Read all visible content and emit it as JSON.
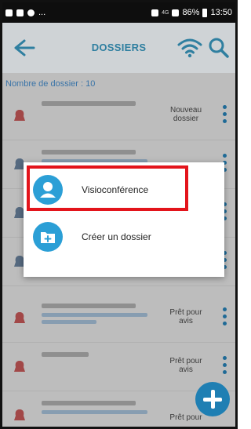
{
  "status_bar": {
    "left_text": "...",
    "battery": "86%",
    "time": "13:50",
    "network_small": "4G"
  },
  "app_bar": {
    "title": "DOSSIERS",
    "icons": [
      "back-arrow-icon",
      "wifi-icon",
      "search-icon"
    ]
  },
  "list": {
    "count_label": "Nombre de dossier :",
    "count_value": "10",
    "rows": [
      {
        "status": "Nouveau dossier"
      },
      {
        "status": ""
      },
      {
        "status": ""
      },
      {
        "status": ""
      },
      {
        "status": ""
      },
      {
        "status": "Prêt pour avis"
      },
      {
        "status": "Prêt pour avis"
      },
      {
        "status": "Prêt pour"
      }
    ]
  },
  "dialog": {
    "options": [
      {
        "label": "Visioconférence",
        "icon": "user-icon"
      },
      {
        "label": "Créer un dossier",
        "icon": "folder-plus-icon"
      }
    ]
  },
  "colors": {
    "accent": "#2f7fa0",
    "app_bar": "#cfd3d6",
    "dialog_icon": "#2b9fd6",
    "highlight": "#e3141b",
    "fab": "#1f7fb3"
  }
}
